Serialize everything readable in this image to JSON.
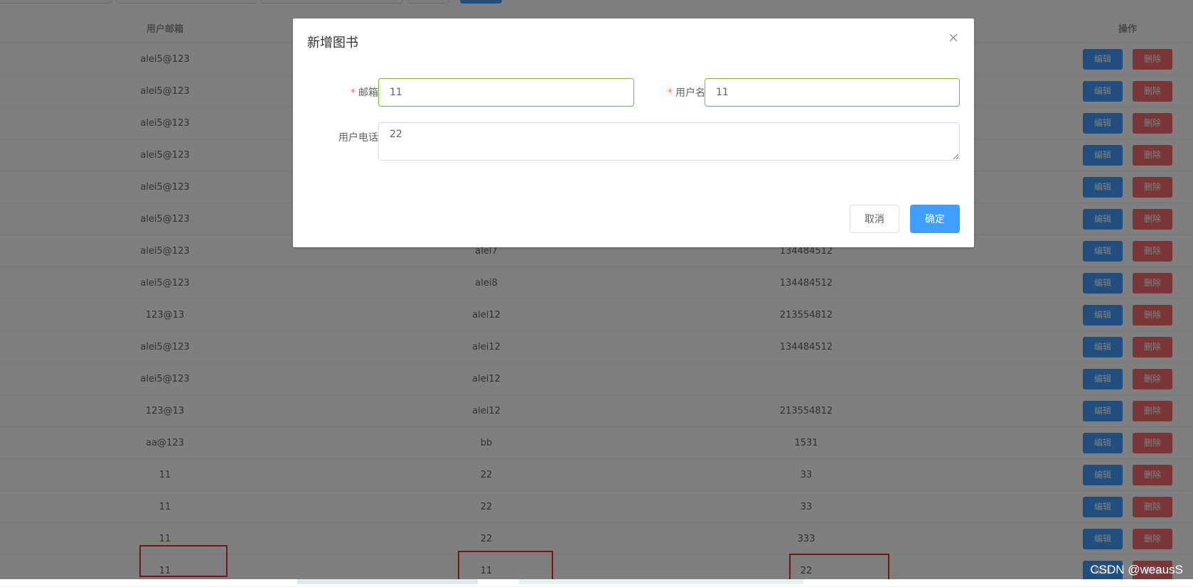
{
  "table": {
    "headers": {
      "email": "用户邮箱",
      "ops": "操作"
    },
    "edit_label": "编辑",
    "delete_label": "删除",
    "rows": [
      {
        "email": "alei5@123",
        "name": "",
        "phone": ""
      },
      {
        "email": "alei5@123",
        "name": "",
        "phone": ""
      },
      {
        "email": "alei5@123",
        "name": "",
        "phone": ""
      },
      {
        "email": "alei5@123",
        "name": "",
        "phone": ""
      },
      {
        "email": "alei5@123",
        "name": "",
        "phone": ""
      },
      {
        "email": "alei5@123",
        "name": "",
        "phone": ""
      },
      {
        "email": "alei5@123",
        "name": "alei7",
        "phone": "134484512"
      },
      {
        "email": "alei5@123",
        "name": "alei8",
        "phone": "134484512"
      },
      {
        "email": "123@13",
        "name": "alei12",
        "phone": "213554812"
      },
      {
        "email": "alei5@123",
        "name": "alei12",
        "phone": "134484512"
      },
      {
        "email": "alei5@123",
        "name": "alei12",
        "phone": ""
      },
      {
        "email": "123@13",
        "name": "alei12",
        "phone": "213554812"
      },
      {
        "email": "aa@123",
        "name": "bb",
        "phone": "1531"
      },
      {
        "email": "11",
        "name": "22",
        "phone": "33"
      },
      {
        "email": "11",
        "name": "22",
        "phone": "33"
      },
      {
        "email": "11",
        "name": "22",
        "phone": "333"
      },
      {
        "email": "11",
        "name": "11",
        "phone": "22"
      }
    ]
  },
  "dialog": {
    "title": "新增图书",
    "email_label": "邮箱",
    "email_value": "11",
    "username_label": "用户名",
    "username_value": "11",
    "phone_label": "用户电话",
    "phone_value": "22",
    "cancel_label": "取消",
    "confirm_label": "确定"
  },
  "watermark": "CSDN @weausS",
  "colors": {
    "primary": "#409eff",
    "danger": "#f56c6c",
    "success_border": "#67c23a",
    "highlight": "#e0322f"
  }
}
